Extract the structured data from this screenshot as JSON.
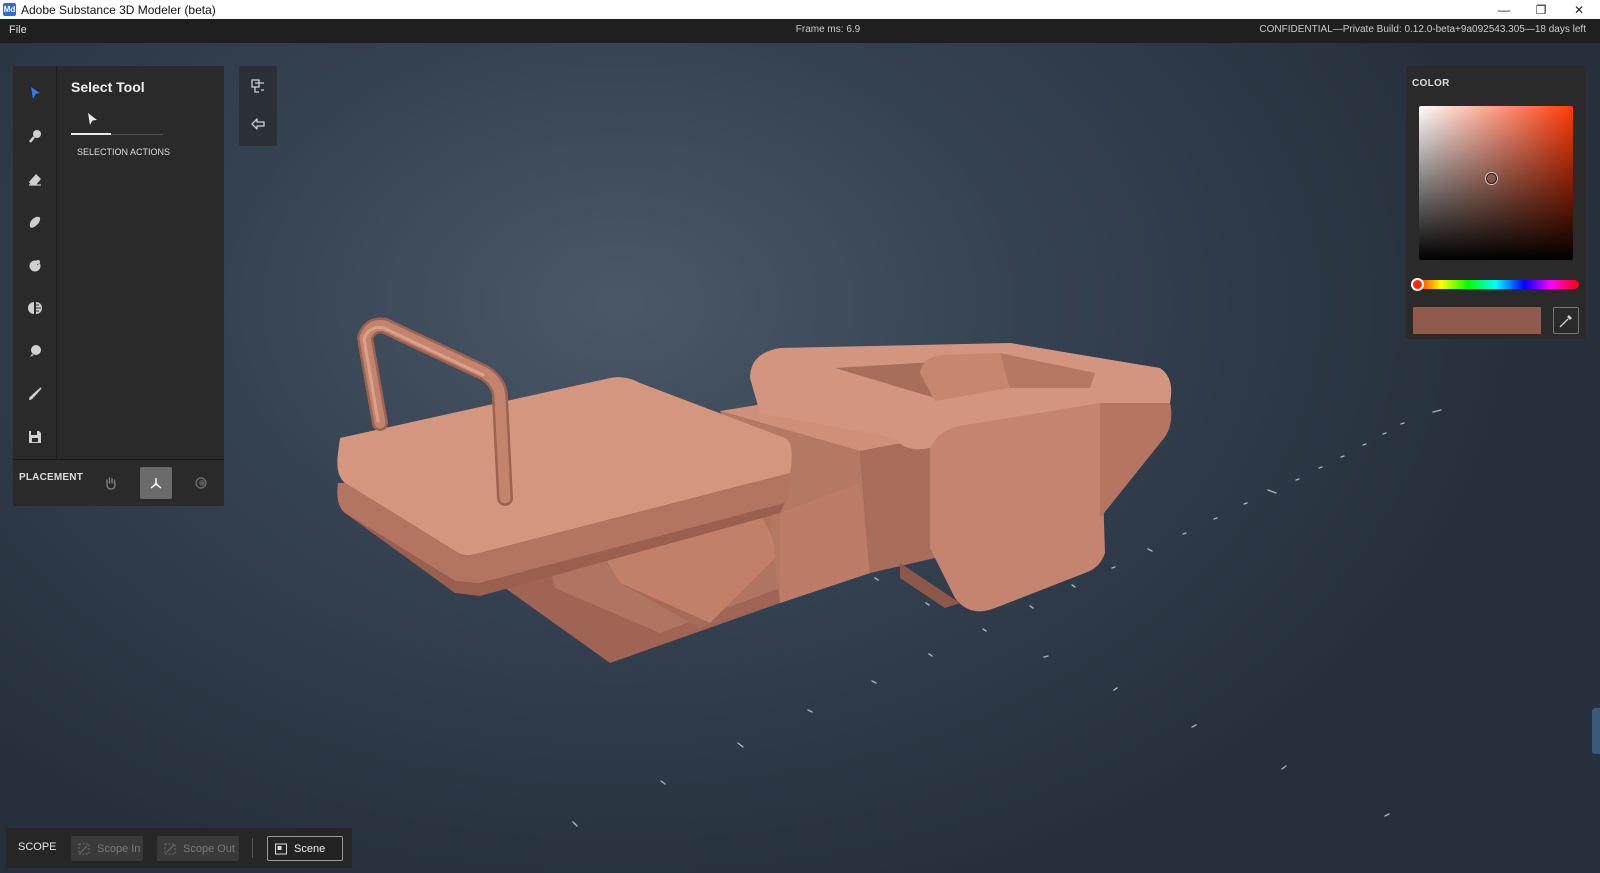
{
  "window": {
    "app_icon": "Md",
    "title": "Adobe Substance 3D Modeler (beta)",
    "minimize_glyph": "—",
    "maximize_glyph": "❐",
    "close_glyph": "✕"
  },
  "menubar": {
    "file_label": "File",
    "frame_ms": "Frame ms: 6.9",
    "build_info": "CONFIDENTIAL—Private Build: 0.12.0-beta+9a092543.305—18 days left"
  },
  "tool_panel": {
    "title": "Select Tool",
    "section_label": "SELECTION ACTIONS",
    "tools": [
      "select-icon",
      "brush-icon",
      "eraser-icon",
      "smooth-icon",
      "stamp-icon",
      "symmetry-icon",
      "balloon-icon",
      "paint-icon",
      "save-icon"
    ],
    "placement_label": "PLACEMENT"
  },
  "color_panel": {
    "label": "COLOR",
    "swatch_color": "#8e5a4a",
    "hue_color": "#ff3b0a"
  },
  "scope_bar": {
    "label": "SCOPE",
    "scope_in_label": "Scope In",
    "scope_out_label": "Scope Out",
    "scene_label": "Scene"
  },
  "colors": {
    "model": "#c88670",
    "panel_bg": "#2a2a2a",
    "accent_blue": "#2f7bf0"
  }
}
